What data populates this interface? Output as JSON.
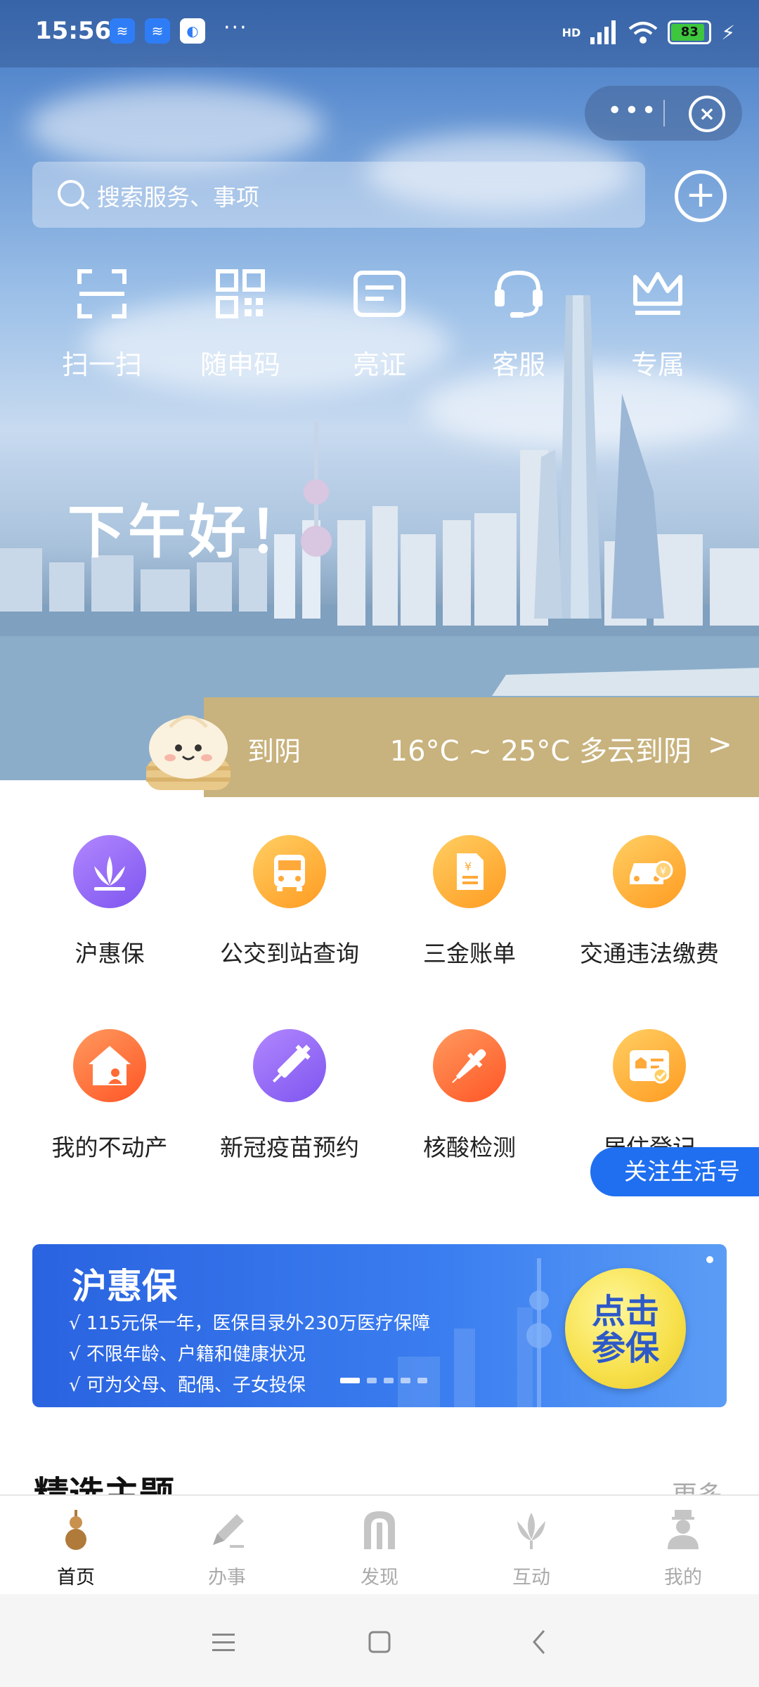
{
  "status_bar": {
    "time": "15:56",
    "icons": [
      "hd-signal-icon",
      "hd-signal-icon",
      "app-notification-icon"
    ],
    "more": "···",
    "signal_label": "HD",
    "battery": "83"
  },
  "miniprogram_capsule": {
    "more": "•••"
  },
  "search": {
    "placeholder": "搜索服务、事项"
  },
  "quick_actions": [
    {
      "label": "扫一扫",
      "icon": "scan-icon"
    },
    {
      "label": "随申码",
      "icon": "qr-code-icon"
    },
    {
      "label": "亮证",
      "icon": "card-icon"
    },
    {
      "label": "客服",
      "icon": "headset-icon"
    },
    {
      "label": "专属",
      "icon": "crown-icon"
    }
  ],
  "greeting": "下午好！",
  "weather": {
    "left_text": "到阴",
    "right_text": "16°C ~ 25°C 多云到阴"
  },
  "services": [
    {
      "label": "沪惠保",
      "icon": "lotus-icon"
    },
    {
      "label": "公交到站查询",
      "icon": "bus-icon"
    },
    {
      "label": "三金账单",
      "icon": "bill-icon"
    },
    {
      "label": "交通违法缴费",
      "icon": "car-fine-icon"
    },
    {
      "label": "我的不动产",
      "icon": "house-icon"
    },
    {
      "label": "新冠疫苗预约",
      "icon": "vaccine-icon"
    },
    {
      "label": "核酸检测",
      "icon": "dropper-icon"
    },
    {
      "label": "居住登记",
      "icon": "residence-card-icon"
    }
  ],
  "follow_button": "关注生活号",
  "banner": {
    "title": "沪惠保",
    "lines": [
      "√ 115元保一年，医保目录外230万医疗保障",
      "√ 不限年龄、户籍和健康状况",
      "√ 可为父母、配偶、子女投保"
    ],
    "cta": [
      "点击",
      "参保"
    ],
    "page_count": 5,
    "active_page": 0
  },
  "section": {
    "title": "精选主题",
    "more": "更多"
  },
  "tabbar": [
    {
      "label": "首页",
      "icon": "gourd-icon",
      "active": true
    },
    {
      "label": "办事",
      "icon": "pen-icon",
      "active": false
    },
    {
      "label": "发现",
      "icon": "gate-icon",
      "active": false
    },
    {
      "label": "互动",
      "icon": "magnolia-icon",
      "active": false
    },
    {
      "label": "我的",
      "icon": "person-icon",
      "active": false
    }
  ],
  "colors": {
    "accent": "#1f6ff0",
    "weather_band": "#c8b27d",
    "tab_active": "#b07a3a"
  }
}
